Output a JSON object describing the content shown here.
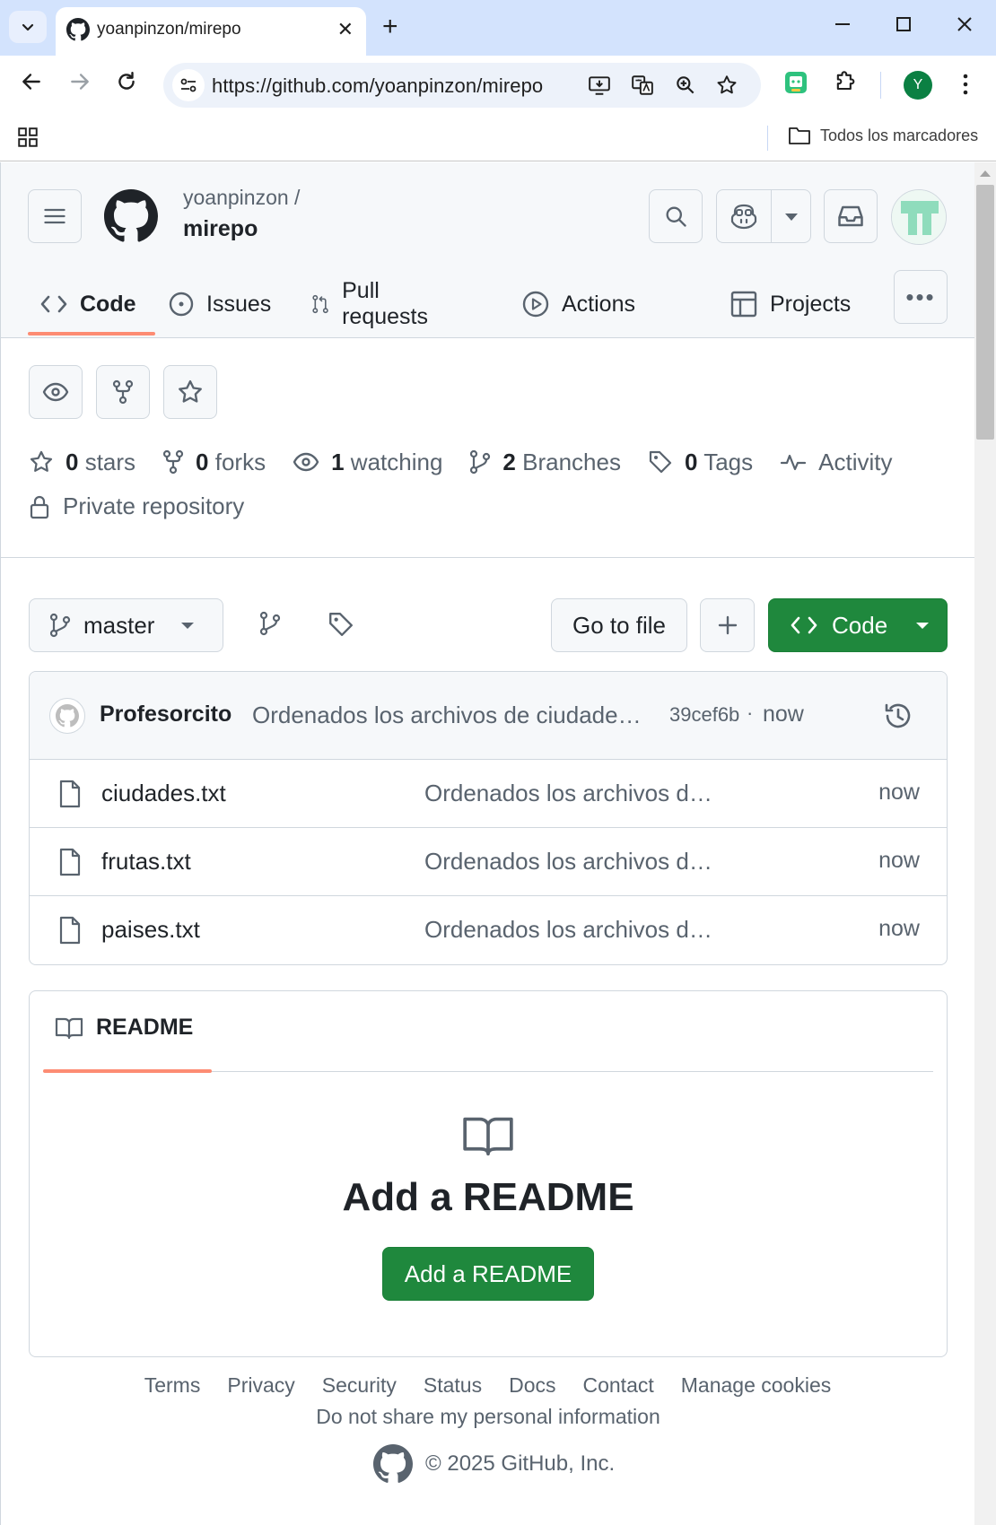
{
  "browser": {
    "tab_title": "yoanpinzon/mirepo",
    "url": "https://github.com/yoanpinzon/mirepo",
    "bookmarks_folder": "Todos los marcadores",
    "profile_initial": "Y"
  },
  "header": {
    "owner": "yoanpinzon /",
    "repo": "mirepo"
  },
  "nav": {
    "code": "Code",
    "issues": "Issues",
    "pull_requests": "Pull requests",
    "actions": "Actions",
    "projects": "Projects",
    "more": "•••"
  },
  "stats": {
    "stars_count": "0",
    "stars_label": "stars",
    "forks_count": "0",
    "forks_label": "forks",
    "watching_count": "1",
    "watching_label": "watching",
    "branches_count": "2",
    "branches_label": "Branches",
    "tags_count": "0",
    "tags_label": "Tags",
    "activity_label": "Activity",
    "private_label": "Private repository"
  },
  "toolbar": {
    "branch": "master",
    "go_to_file": "Go to file",
    "code_button": "Code"
  },
  "commit": {
    "author": "Profesorcito",
    "message": "Ordenados los archivos de ciudade…",
    "sha": "39cef6b",
    "dot": "·",
    "time": "now"
  },
  "files": [
    {
      "name": "ciudades.txt",
      "message": "Ordenados los archivos d…",
      "time": "now"
    },
    {
      "name": "frutas.txt",
      "message": "Ordenados los archivos d…",
      "time": "now"
    },
    {
      "name": "paises.txt",
      "message": "Ordenados los archivos d…",
      "time": "now"
    }
  ],
  "readme": {
    "tab_label": "README",
    "title": "Add a README",
    "button": "Add a README"
  },
  "footer": {
    "links": [
      "Terms",
      "Privacy",
      "Security",
      "Status",
      "Docs",
      "Contact",
      "Manage cookies"
    ],
    "line2": "Do not share my personal information",
    "copyright": "© 2025 GitHub, Inc."
  },
  "colors": {
    "accent_green": "#1f883d",
    "tab_underline": "#fd8c73",
    "chrome_blue": "#d3e3fd"
  }
}
